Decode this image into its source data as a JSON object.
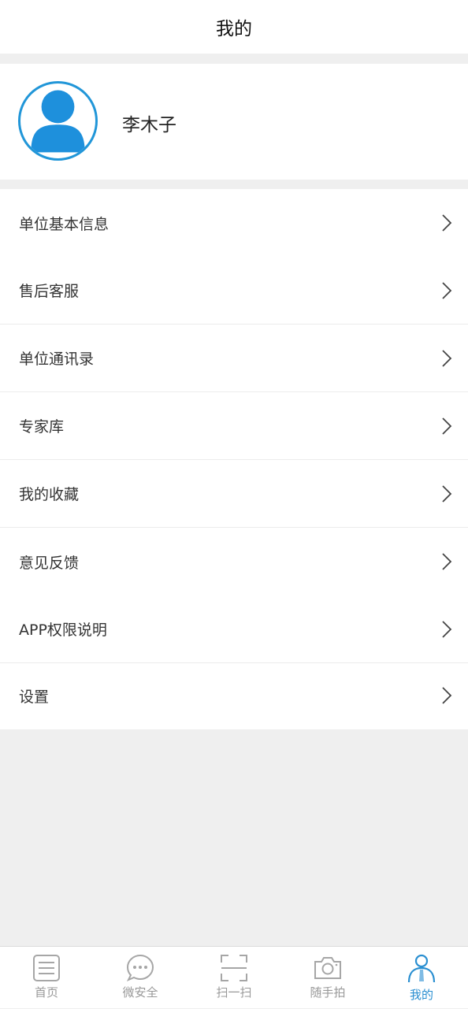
{
  "header": {
    "title": "我的"
  },
  "profile": {
    "username": "李木子",
    "avatar_icon": "user-avatar-icon"
  },
  "menu": {
    "items": [
      {
        "label": "单位基本信息"
      },
      {
        "label": "售后客服"
      },
      {
        "label": "单位通讯录"
      },
      {
        "label": "专家库"
      },
      {
        "label": "我的收藏"
      },
      {
        "label": "意见反馈"
      },
      {
        "label": "APP权限说明"
      },
      {
        "label": "设置"
      }
    ]
  },
  "tabbar": {
    "active_color": "#2a8fd1",
    "inactive_color": "#999999",
    "tabs": [
      {
        "label": "首页",
        "icon": "home-list-icon"
      },
      {
        "label": "微安全",
        "icon": "chat-bubble-icon"
      },
      {
        "label": "扫一扫",
        "icon": "scan-icon"
      },
      {
        "label": "随手拍",
        "icon": "camera-icon"
      },
      {
        "label": "我的",
        "icon": "person-icon",
        "active": true
      }
    ]
  }
}
